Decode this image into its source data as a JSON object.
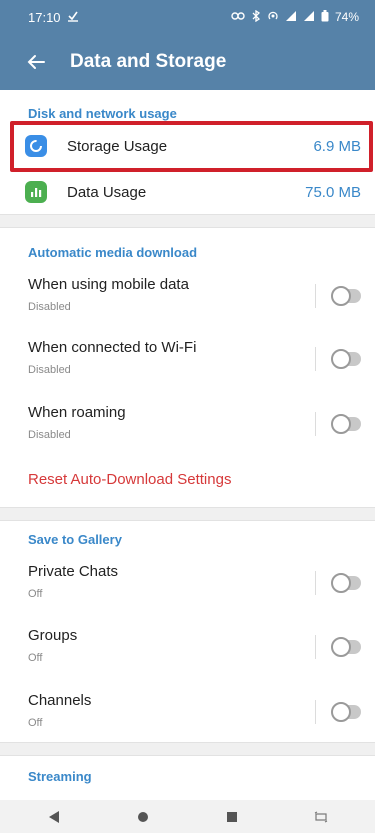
{
  "status_bar": {
    "time": "17:10",
    "battery": "74%"
  },
  "app_bar": {
    "title": "Data and Storage"
  },
  "disk_section": {
    "header": "Disk and network usage",
    "items": [
      {
        "label": "Storage Usage",
        "value": "6.9 MB",
        "icon_color": "#3a8ee6"
      },
      {
        "label": "Data Usage",
        "value": "75.0 MB",
        "icon_color": "#4caf50"
      }
    ]
  },
  "auto_download": {
    "header": "Automatic media download",
    "items": [
      {
        "title": "When using mobile data",
        "status": "Disabled"
      },
      {
        "title": "When connected to Wi-Fi",
        "status": "Disabled"
      },
      {
        "title": "When roaming",
        "status": "Disabled"
      }
    ],
    "reset_label": "Reset Auto-Download Settings"
  },
  "gallery": {
    "header": "Save to Gallery",
    "items": [
      {
        "title": "Private Chats",
        "status": "Off"
      },
      {
        "title": "Groups",
        "status": "Off"
      },
      {
        "title": "Channels",
        "status": "Off"
      }
    ]
  },
  "streaming": {
    "header": "Streaming"
  },
  "colors": {
    "primary": "#5682a8",
    "accent": "#3a88c9",
    "danger": "#d6393a",
    "highlight_border": "#d0202a"
  }
}
